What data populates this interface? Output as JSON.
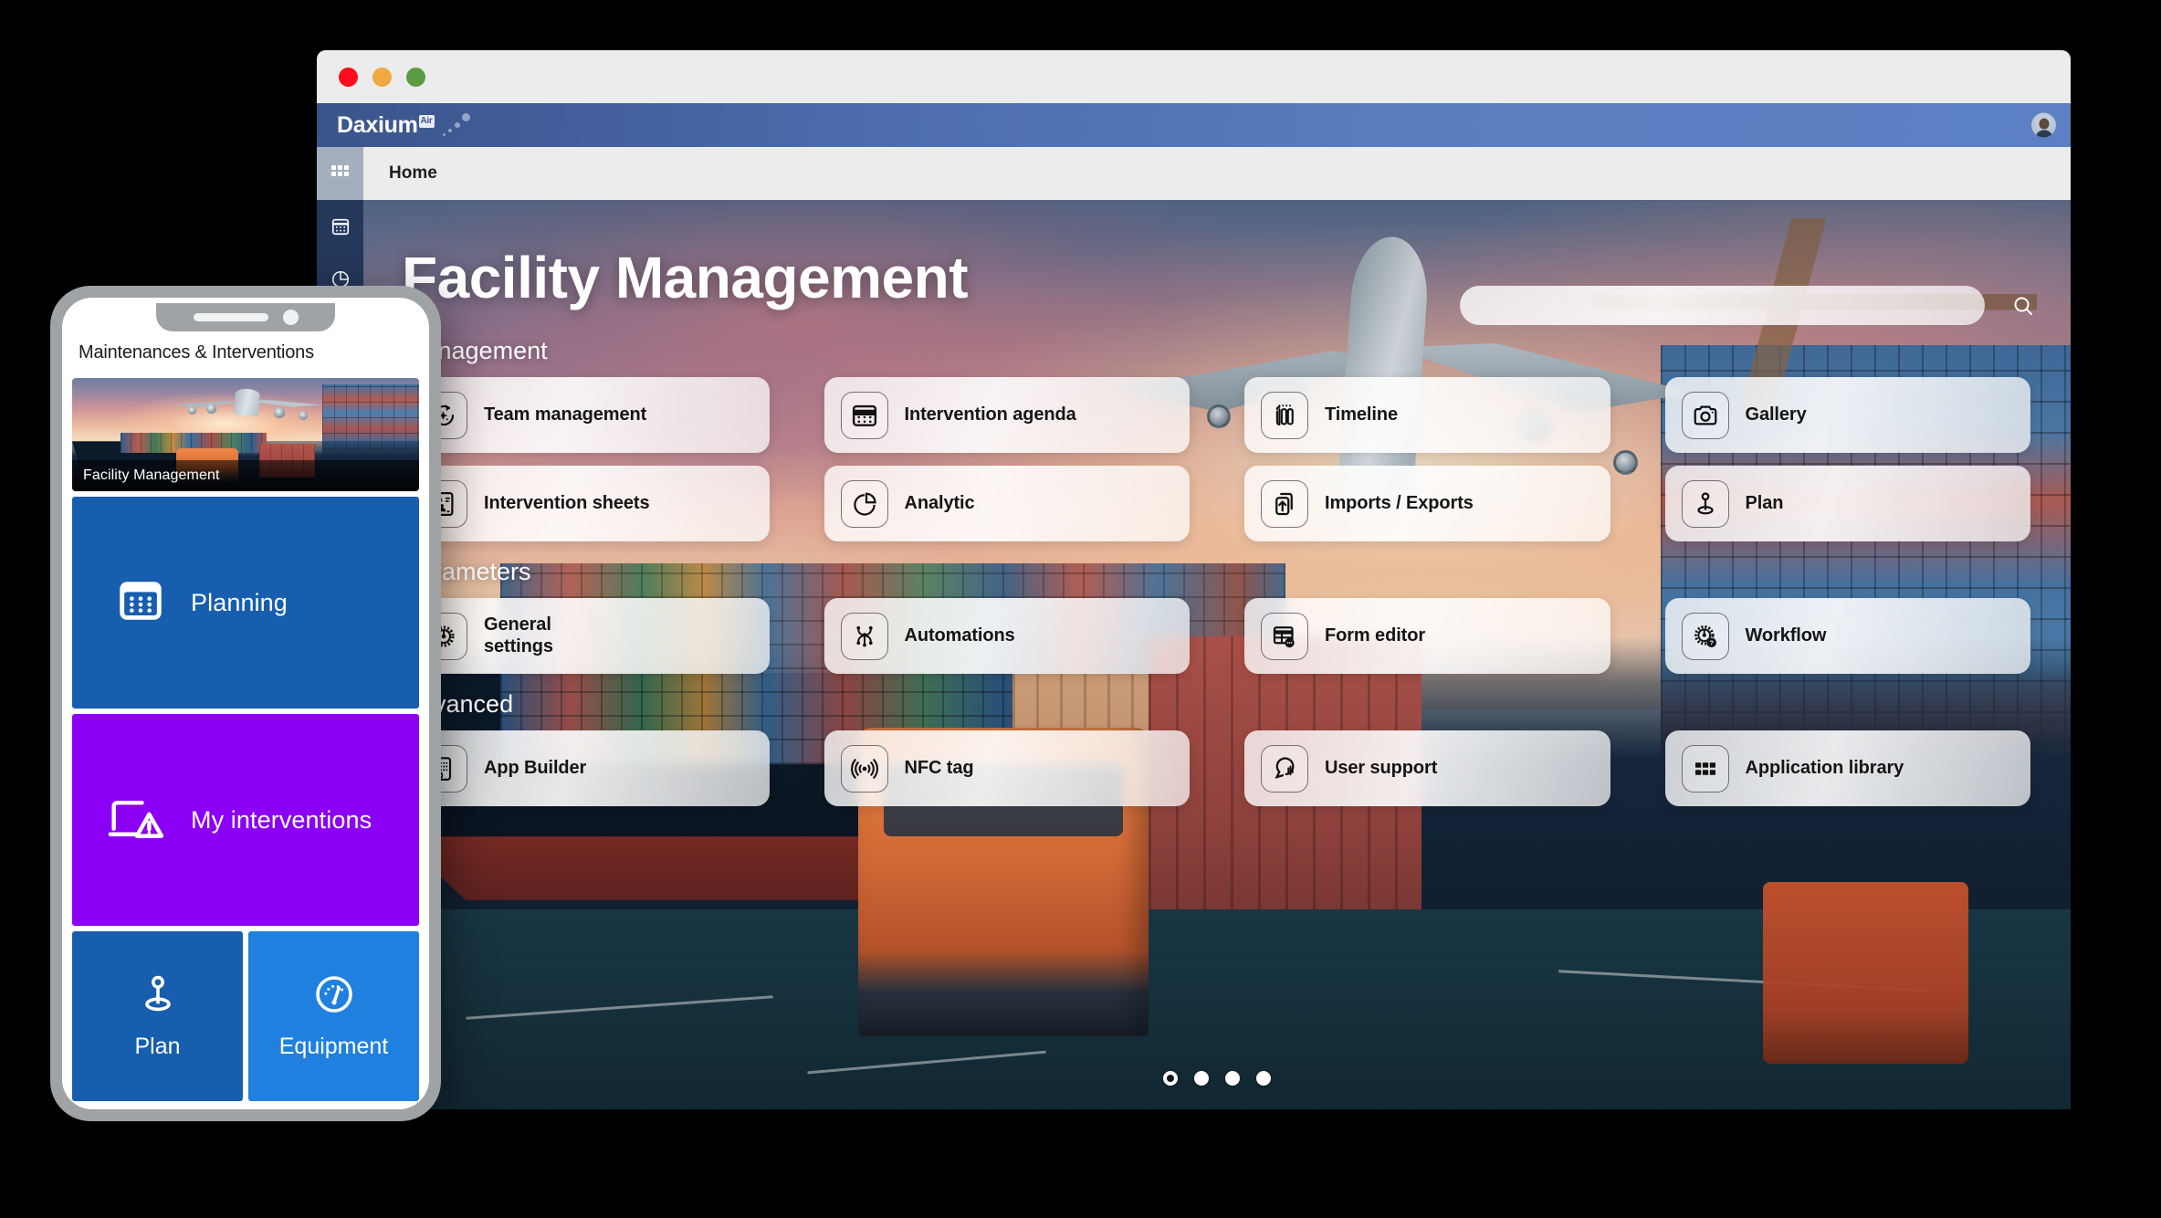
{
  "window": {
    "titlebar": {
      "close_label": "close",
      "minimize_label": "minimize",
      "maximize_label": "maximize"
    },
    "brand": {
      "name": "Daxium",
      "superscript": "Air"
    },
    "breadcrumb": "Home"
  },
  "rail": {
    "items": [
      {
        "icon": "grid-icon",
        "active": true
      },
      {
        "icon": "calendar-icon",
        "active": false
      },
      {
        "icon": "pie-chart-icon",
        "active": false
      }
    ]
  },
  "hero": {
    "title": "Facility Management",
    "search": {
      "value": "",
      "placeholder": "",
      "icon": "search-icon"
    },
    "pagination": {
      "count": 4,
      "active_index": 0
    }
  },
  "sections": [
    {
      "label": "Management",
      "tiles": [
        {
          "label": "Team management",
          "icon": "team-refresh-icon"
        },
        {
          "label": "Intervention agenda",
          "icon": "calendar-icon"
        },
        {
          "label": "Timeline",
          "icon": "timeline-icon"
        },
        {
          "label": "Gallery",
          "icon": "camera-icon"
        },
        {
          "label": "Intervention sheets",
          "icon": "id-card-icon"
        },
        {
          "label": "Analytic",
          "icon": "pie-chart-icon"
        },
        {
          "label": "Imports / Exports",
          "icon": "import-export-icon"
        },
        {
          "label": "Plan",
          "icon": "map-pin-icon"
        }
      ]
    },
    {
      "label": "Parameters",
      "tiles": [
        {
          "label": "General\nsettings",
          "icon": "gear-icon"
        },
        {
          "label": "Automations",
          "icon": "automation-nodes-icon"
        },
        {
          "label": "Form editor",
          "icon": "table-form-icon"
        },
        {
          "label": "Workflow",
          "icon": "gear-question-icon"
        }
      ]
    },
    {
      "label": "Advanced",
      "tiles": [
        {
          "label": "App Builder",
          "icon": "app-builder-icon"
        },
        {
          "label": "NFC tag",
          "icon": "nfc-icon"
        },
        {
          "label": "User support",
          "icon": "support-chat-icon"
        },
        {
          "label": "Application library",
          "icon": "apps-grid-icon"
        }
      ]
    }
  ],
  "phone": {
    "header": "Maintenances & Interventions",
    "image_card": {
      "caption": "Facility Management"
    },
    "tiles": [
      {
        "label": "Planning",
        "icon": "calendar-icon",
        "color": "#175eae"
      },
      {
        "label": "My interventions",
        "icon": "laptop-warning-icon",
        "color": "#8b00f5"
      }
    ],
    "square_tiles": [
      {
        "label": "Plan",
        "icon": "map-pin-icon",
        "color": "#175eae"
      },
      {
        "label": "Equipment",
        "icon": "gauge-icon",
        "color": "#2080e0"
      }
    ]
  },
  "colors": {
    "brand_blue": "#4c6cae",
    "rail_dark": "#24385c",
    "tile_blue": "#175eae",
    "tile_purple": "#8b00f5",
    "tile_light_blue": "#2080e0",
    "window_chrome": "#ececec"
  }
}
